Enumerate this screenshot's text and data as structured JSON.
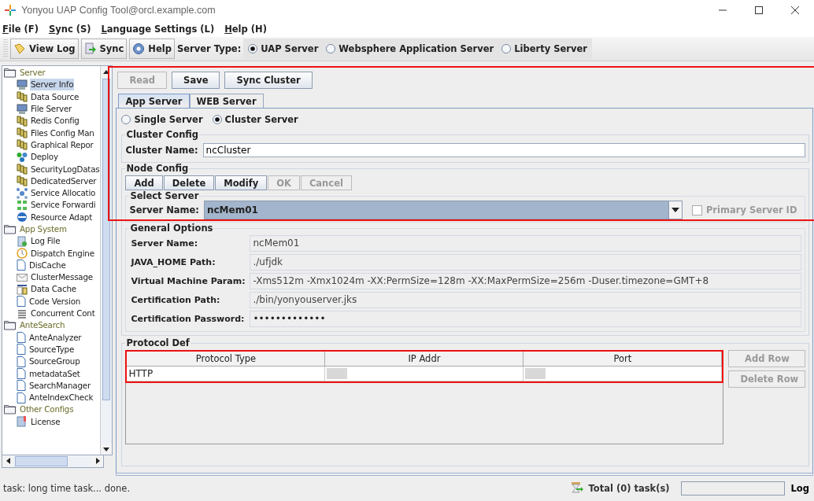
{
  "window": {
    "title": "Yonyou UAP Config Tool@orcl.example.com"
  },
  "menu": [
    {
      "label": "File (F)"
    },
    {
      "label": "Sync (S)"
    },
    {
      "label": "Language Settings (L)"
    },
    {
      "label": "Help (H)"
    }
  ],
  "toolbar": {
    "buttons": [
      {
        "label": "View Log",
        "kind": "log"
      },
      {
        "label": "Sync",
        "kind": "sync"
      },
      {
        "label": "Help",
        "kind": "help"
      }
    ],
    "server_type_label": "Server Type:",
    "server_types": [
      {
        "label": "UAP Server",
        "selected": true
      },
      {
        "label": "Websphere Application Server",
        "selected": false
      },
      {
        "label": "Liberty Server",
        "selected": false
      }
    ]
  },
  "sidebar": {
    "tree": [
      {
        "label": "Server",
        "selected": false,
        "kind": "folder",
        "children": [
          {
            "label": "Server Info",
            "selected": true,
            "kind": "monitor"
          },
          {
            "label": "Data Source",
            "selected": false,
            "kind": "cluster"
          },
          {
            "label": "File Server",
            "selected": false,
            "kind": "monitor"
          },
          {
            "label": "Redis Config",
            "selected": false,
            "kind": "cluster"
          },
          {
            "label": "Files Config Man",
            "selected": false,
            "kind": "cluster"
          },
          {
            "label": "Graphical Repor",
            "selected": false,
            "kind": "cluster"
          },
          {
            "label": "Deploy",
            "selected": false,
            "kind": "deploy"
          },
          {
            "label": "SecurityLogDatas",
            "selected": false,
            "kind": "cluster"
          },
          {
            "label": "DedicatedServer",
            "selected": false,
            "kind": "cluster"
          },
          {
            "label": "Service Allocatio",
            "selected": false,
            "kind": "network"
          },
          {
            "label": "Service Forwardi",
            "selected": false,
            "kind": "squares"
          },
          {
            "label": "Resource Adapt",
            "selected": false,
            "kind": "disc"
          }
        ]
      },
      {
        "label": "App System",
        "selected": false,
        "kind": "folder",
        "children": [
          {
            "label": "Log File",
            "selected": false,
            "kind": "logfile"
          },
          {
            "label": "Dispatch Engine",
            "selected": false,
            "kind": "clock"
          },
          {
            "label": "DisCache",
            "selected": false,
            "kind": "doc"
          },
          {
            "label": "ClusterMessage",
            "selected": false,
            "kind": "mail"
          },
          {
            "label": "Data Cache",
            "selected": false,
            "kind": "grid"
          },
          {
            "label": "Code Version",
            "selected": false,
            "kind": "doc"
          },
          {
            "label": "Concurrent Cont",
            "selected": false,
            "kind": "lines"
          }
        ]
      },
      {
        "label": "AnteSearch",
        "selected": false,
        "kind": "folder",
        "children": [
          {
            "label": "AnteAnalyzer",
            "selected": false,
            "kind": "doc"
          },
          {
            "label": "SourceType",
            "selected": false,
            "kind": "doc"
          },
          {
            "label": "SourceGroup",
            "selected": false,
            "kind": "doc"
          },
          {
            "label": "metadataSet",
            "selected": false,
            "kind": "doc"
          },
          {
            "label": "SearchManager",
            "selected": false,
            "kind": "doc"
          },
          {
            "label": "AnteIndexCheck",
            "selected": false,
            "kind": "doc"
          }
        ]
      },
      {
        "label": "Other Configs",
        "selected": false,
        "kind": "folder",
        "children": [
          {
            "label": "License",
            "selected": false,
            "kind": "license"
          }
        ]
      }
    ]
  },
  "actions": [
    {
      "label": "Read",
      "disabled": true
    },
    {
      "label": "Save",
      "disabled": false
    },
    {
      "label": "Sync Cluster",
      "disabled": false
    }
  ],
  "tabs": [
    {
      "label": "App Server",
      "selected": true
    },
    {
      "label": "WEB Server",
      "selected": false
    }
  ],
  "mode": [
    {
      "label": "Single Server",
      "selected": false
    },
    {
      "label": "Cluster Server",
      "selected": true
    }
  ],
  "cluster_config": {
    "title": "Cluster Config",
    "label": "Cluster Name:",
    "value": "ncCluster"
  },
  "node_config": {
    "title": "Node Config",
    "buttons": [
      {
        "label": "Add",
        "disabled": false
      },
      {
        "label": "Delete",
        "disabled": false
      },
      {
        "label": "Modify",
        "disabled": false
      },
      {
        "label": "OK",
        "disabled": true
      },
      {
        "label": "Cancel",
        "disabled": true
      }
    ],
    "select_server": {
      "title": "Select Server",
      "label": "Server Name:",
      "value": "ncMem01",
      "primary": {
        "label": "Primary Server ID",
        "checked": false,
        "disabled": true
      }
    }
  },
  "general_options": {
    "title": "General Options",
    "fields": [
      {
        "label": "Server Name:",
        "value": "ncMem01",
        "kind": "text"
      },
      {
        "label": "JAVA_HOME Path:",
        "value": "./ufjdk",
        "kind": "text"
      },
      {
        "label": "Virtual Machine Param:",
        "value": "-Xms512m -Xmx1024m -XX:PermSize=128m -XX:MaxPermSize=256m -Duser.timezone=GMT+8",
        "kind": "text"
      },
      {
        "label": "Certification Path:",
        "value": "./bin/yonyouserver.jks",
        "kind": "text"
      },
      {
        "label": "Certification Password:",
        "value": "•••••••••••••",
        "kind": "password"
      }
    ]
  },
  "protocol_def": {
    "title": "Protocol Def",
    "table": {
      "columns": [
        "Protocol Type",
        "IP Addr",
        "Port"
      ],
      "rows": [
        {
          "cells": [
            {
              "text": "HTTP",
              "kind": "text"
            },
            {
              "kind": "redacted"
            },
            {
              "kind": "redacted"
            }
          ]
        }
      ]
    },
    "buttons": [
      {
        "label": "Add Row",
        "disabled": true
      },
      {
        "label": "Delete Row",
        "disabled": true
      }
    ]
  },
  "status_bar": {
    "message": "task: long time task... done.",
    "tasks": "Total (0) task(s)",
    "progress": {
      "level": 0
    },
    "log": "Log"
  }
}
